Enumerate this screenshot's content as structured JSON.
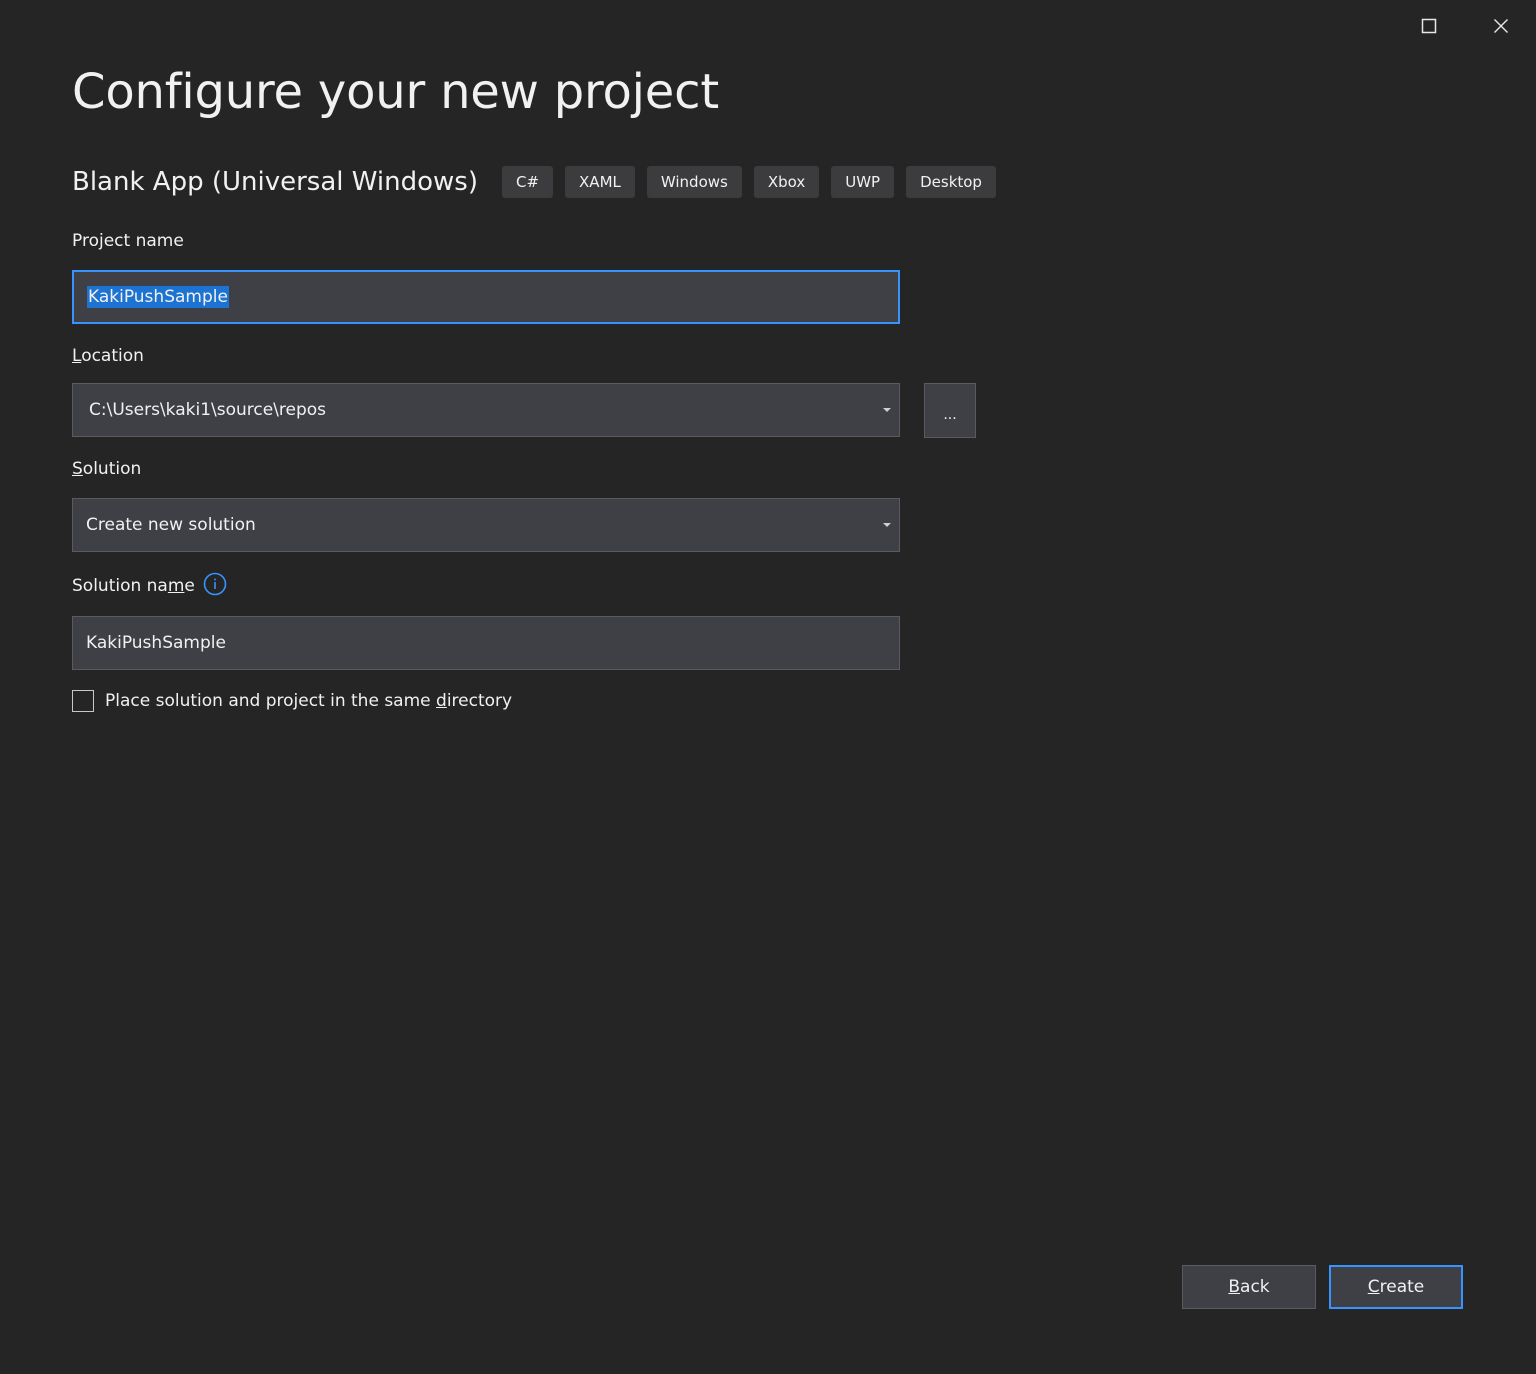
{
  "window": {
    "maximize_icon": "maximize-icon",
    "close_icon": "close-icon"
  },
  "page": {
    "title": "Configure your new project"
  },
  "template": {
    "name": "Blank App (Universal Windows)",
    "tags": [
      "C#",
      "XAML",
      "Windows",
      "Xbox",
      "UWP",
      "Desktop"
    ]
  },
  "project_name": {
    "label": "Project name",
    "value": "KakiPushSample",
    "selected": true
  },
  "location": {
    "label_first": "L",
    "label_rest": "ocation",
    "value": "C:\\Users\\kaki1\\source\\repos",
    "browse_label": "..."
  },
  "solution": {
    "label_first": "S",
    "label_rest": "olution",
    "value": "Create new solution"
  },
  "solution_name": {
    "label_pre": "Solution na",
    "label_u": "m",
    "label_post": "e",
    "value": "KakiPushSample",
    "info_icon": "info-icon"
  },
  "same_directory": {
    "label_pre": "Place solution and project in the same ",
    "label_u": "d",
    "label_post": "irectory",
    "checked": false
  },
  "footer": {
    "back_first": "B",
    "back_rest": "ack",
    "create_first": "C",
    "create_rest": "reate"
  },
  "colors": {
    "background": "#252526",
    "input_bg": "#3f3f46",
    "accent": "#3794ff",
    "selection": "#1c73d1"
  }
}
